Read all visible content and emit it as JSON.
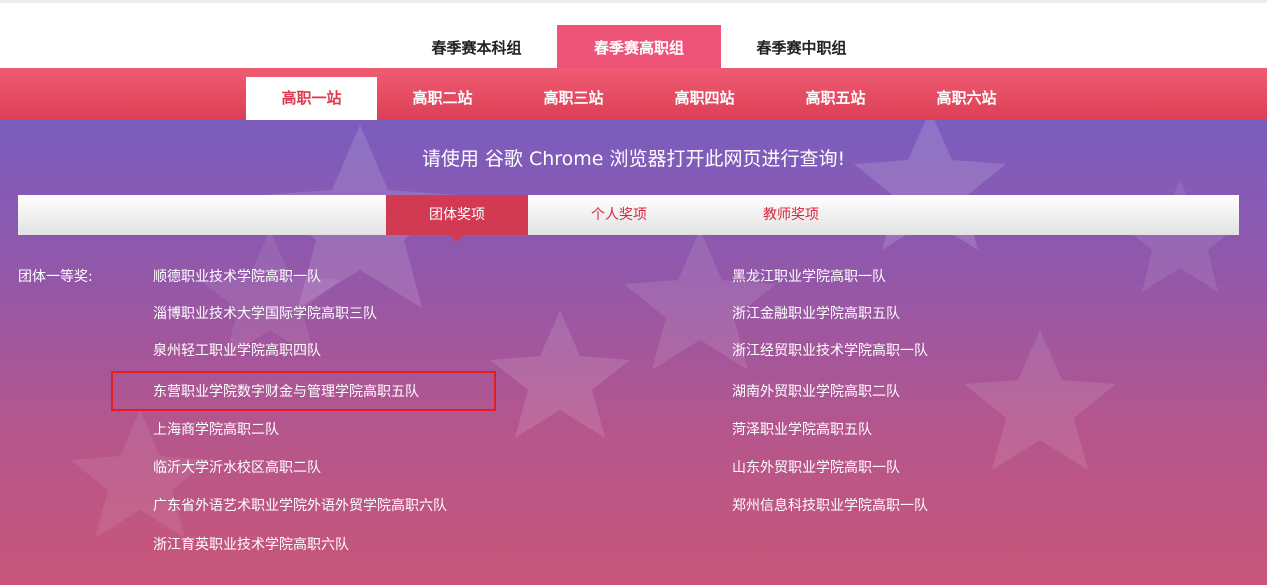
{
  "top_tabs": [
    "春季赛本科组",
    "春季赛高职组",
    "春季赛中职组"
  ],
  "top_active": "春季赛高职组",
  "station_tabs": [
    "高职一站",
    "高职二站",
    "高职三站",
    "高职四站",
    "高职五站",
    "高职六站"
  ],
  "station_active": "高职一站",
  "notice": "请使用 谷歌 Chrome 浏览器打开此网页进行查询!",
  "award_tabs": [
    "团体奖项",
    "个人奖项",
    "教师奖项"
  ],
  "award_active": "团体奖项",
  "prize_label": "团体一等奖:",
  "left_teams": [
    "顺德职业技术学院高职一队",
    "淄博职业技术大学国际学院高职三队",
    "泉州轻工职业学院高职四队",
    "东营职业学院数字财金与管理学院高职五队",
    "上海商学院高职二队",
    "临沂大学沂水校区高职二队",
    "广东省外语艺术职业学院外语外贸学院高职六队",
    "浙江育英职业技术学院高职六队"
  ],
  "right_teams": [
    "黑龙江职业学院高职一队",
    "浙江金融职业学院高职五队",
    "浙江经贸职业技术学院高职一队",
    "湖南外贸职业学院高职二队",
    "菏泽职业学院高职五队",
    "山东外贸职业学院高职一队",
    "郑州信息科技职业学院高职一队"
  ],
  "highlighted_team": "东营职业学院数字财金与管理学院高职五队",
  "colors": {
    "accent_pink": "#ed5478",
    "station_red": "#dc3f55",
    "highlight_border": "#e02020"
  }
}
